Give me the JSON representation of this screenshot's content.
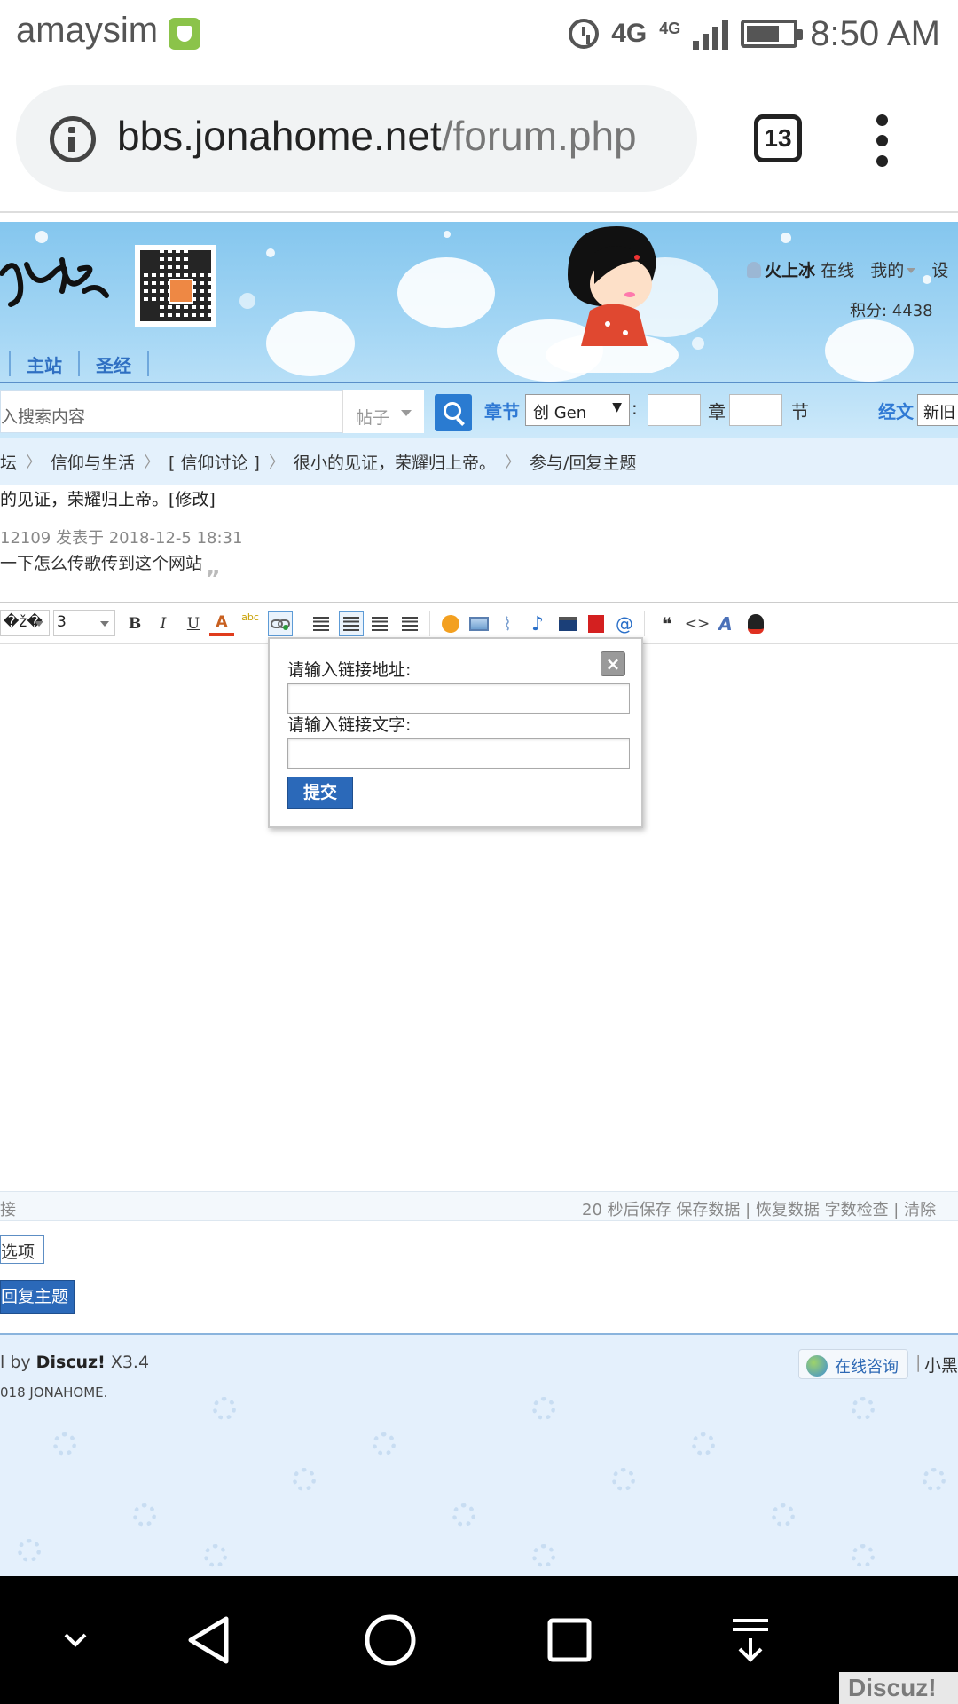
{
  "status_bar": {
    "carrier": "amaysim",
    "network_main": "4G",
    "network_sub": "4G",
    "time": "8:50 AM"
  },
  "browser": {
    "url_host": "bbs.jonahome.net",
    "url_path": "/forum.php",
    "tab_count": "13"
  },
  "header": {
    "nav_links": [
      "主站",
      "圣经"
    ],
    "username": "火上冰",
    "online_status": "在线",
    "my_menu": "我的",
    "settings_partial": "设",
    "credits": "积分: 4438",
    "search_placeholder": "入搜索内容",
    "search_type": "帖子",
    "chapter_label": "章节",
    "book_selected": "创 Gen",
    "book_arrow": "▼",
    "colon": ":",
    "chapter_unit": "章",
    "verse_unit": "节",
    "scripture_label": "经文",
    "version_selected": "新旧"
  },
  "breadcrumb": [
    "坛",
    "信仰与生活",
    "[ 信仰讨论 ]",
    "很小的见证，荣耀归上帝。",
    "参与/回复主题"
  ],
  "breadcrumb_sep": "〉",
  "thread": {
    "title": "的见证，荣耀归上帝。[修改]",
    "quote_meta": "12109 发表于 2018-12-5 18:31",
    "quote_text": "一下怎么传歌传到这个网站",
    "quote_mark": "„"
  },
  "toolbar": {
    "font_partial": "�ž�",
    "font_size": "3",
    "bold": "B",
    "italic": "I",
    "underline": "U",
    "font_color": "A",
    "highlight": "abc",
    "quote": "❝",
    "code": "<>",
    "at": "@"
  },
  "link_dialog": {
    "close": "×",
    "url_label": "请输入链接地址:",
    "text_label": "请输入链接文字:",
    "submit": "提交"
  },
  "editor_status": {
    "left_partial": "接",
    "autosave": "20 秒后保存 保存数据 | 恢复数据    字数检查 | 清除"
  },
  "post": {
    "options_label": "选项",
    "reply_label": "回复主题"
  },
  "footer": {
    "powered_prefix": "l by",
    "powered_brand": "Discuz!",
    "powered_version": "X3.4",
    "copyright": "018 JONAHOME.",
    "consult": "在线咨询",
    "separator": "|",
    "link_partial": "小黑"
  },
  "watermark": "Discuz!"
}
